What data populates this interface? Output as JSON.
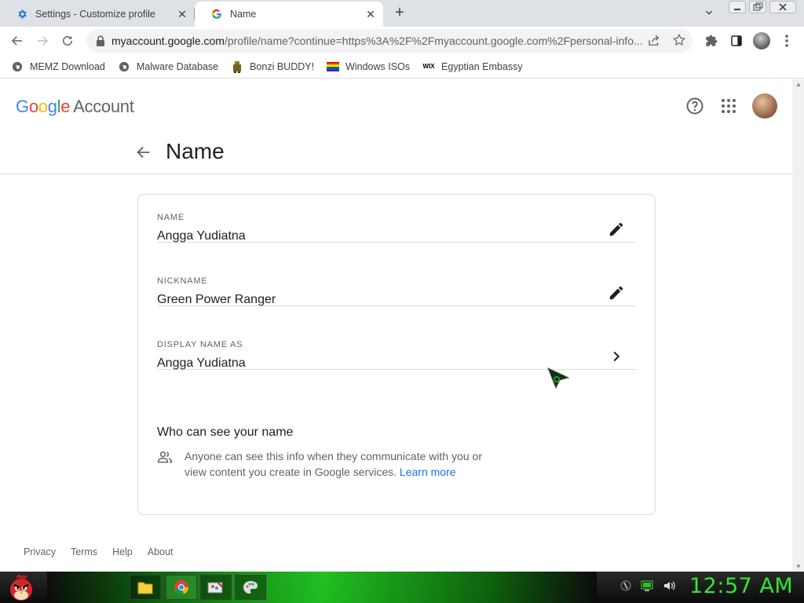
{
  "browser": {
    "tabs": [
      {
        "title": "Settings - Customize profile",
        "icon": "gear-icon",
        "active": false
      },
      {
        "title": "Name",
        "icon": "google-g-icon",
        "active": true
      }
    ],
    "address": {
      "host": "myaccount.google.com",
      "path": "/profile/name?continue=https%3A%2F%2Fmyaccount.google.com%2Fpersonal-info..."
    },
    "bookmarks": [
      {
        "label": "MEMZ Download",
        "icon": "globe-icon"
      },
      {
        "label": "Malware Database",
        "icon": "globe-icon"
      },
      {
        "label": "Bonzi BUDDY!",
        "icon": "bonzi-icon"
      },
      {
        "label": "Windows ISOs",
        "icon": "rainbow-flag-icon"
      },
      {
        "label": "Egyptian Embassy",
        "icon": "wix-icon"
      }
    ]
  },
  "header": {
    "logo_letters": [
      "G",
      "o",
      "o",
      "g",
      "l",
      "e"
    ],
    "logo_suffix": "Account"
  },
  "page": {
    "title": "Name",
    "rows": [
      {
        "label": "NAME",
        "value": "Angga Yudiatna",
        "action": "edit-pencil-icon"
      },
      {
        "label": "NICKNAME",
        "value": "Green Power Ranger",
        "action": "edit-pencil-icon"
      },
      {
        "label": "DISPLAY NAME AS",
        "value": "Angga Yudiatna",
        "action": "chevron-right-icon"
      }
    ],
    "who": {
      "title": "Who can see your name",
      "text": "Anyone can see this info when they communicate with you or view content you create in Google services.",
      "link": "Learn more"
    }
  },
  "footer": {
    "links": [
      "Privacy",
      "Terms",
      "Help",
      "About"
    ]
  },
  "taskbar": {
    "clock": "12:57 AM"
  },
  "colors": {
    "accent_blue": "#1a73e8",
    "taskbar_green": "#2fe82f"
  }
}
